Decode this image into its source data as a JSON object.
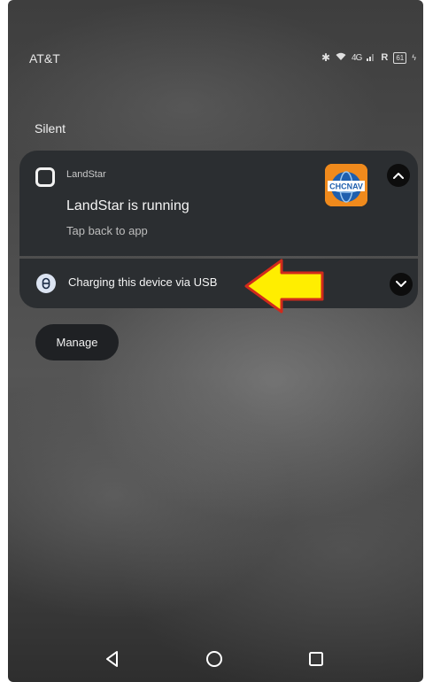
{
  "status_bar": {
    "carrier": "AT&T",
    "icons": [
      "bluetooth-icon",
      "wifi-icon",
      "signal-icon",
      "roaming-icon",
      "battery-icon"
    ],
    "network": "4G",
    "roaming": "R",
    "battery": "61"
  },
  "section": {
    "label": "Silent"
  },
  "notification": {
    "app_name": "LandStar",
    "title": "LandStar is running",
    "text": "Tap back to app",
    "logo_text": "CHCNAV"
  },
  "usb_notification": {
    "text": "Charging this device via USB"
  },
  "manage": {
    "label": "Manage"
  },
  "colors": {
    "card_bg": "#2b2e31",
    "arrow_fill": "#ffee00",
    "arrow_stroke": "#d12a1c",
    "logo_orange": "#f08a1c",
    "logo_blue": "#1f5fae"
  }
}
